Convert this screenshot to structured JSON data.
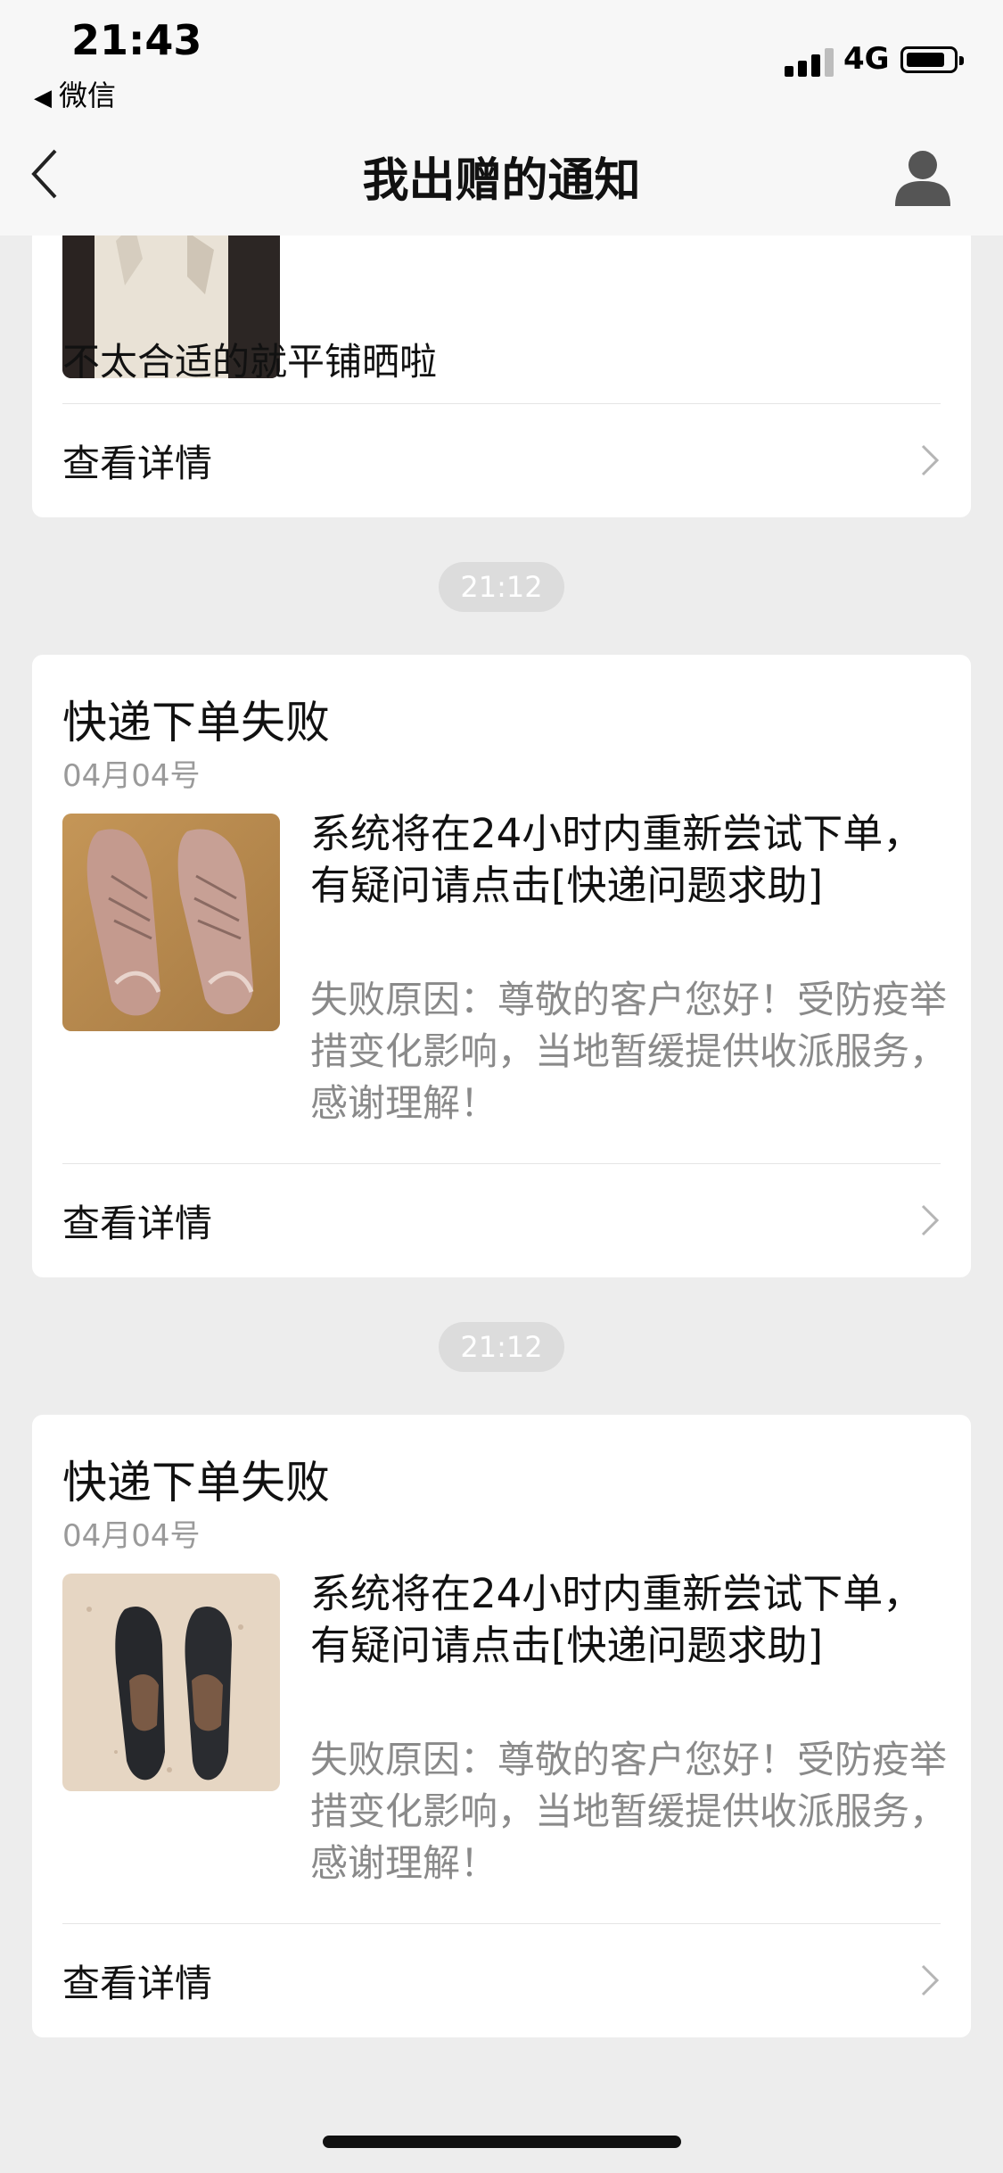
{
  "status_bar": {
    "time": "21:43",
    "back_app": "微信",
    "network": "4G"
  },
  "nav": {
    "title": "我出赠的通知",
    "back_icon": "chevron-left-icon",
    "user_icon": "user-icon"
  },
  "partial_card": {
    "text": "不太合适的就平铺晒啦",
    "detail_label": "查看详情"
  },
  "notifications": [
    {
      "time": "21:12",
      "title": "快递下单失败",
      "date": "04月04号",
      "description": "系统将在24小时内重新尝试下单，有疑问请点击[快递问题求助]",
      "reason": "失败原因：尊敬的客户您好！受防疫举措变化影响，当地暂缓提供收派服务，感谢理解！",
      "detail_label": "查看详情",
      "image": "pink-sneakers"
    },
    {
      "time": "21:12",
      "title": "快递下单失败",
      "date": "04月04号",
      "description": "系统将在24小时内重新尝试下单，有疑问请点击[快递问题求助]",
      "reason": "失败原因：尊敬的客户您好！受防疫举措变化影响，当地暂缓提供收派服务，感谢理解！",
      "detail_label": "查看详情",
      "image": "black-heels"
    }
  ]
}
